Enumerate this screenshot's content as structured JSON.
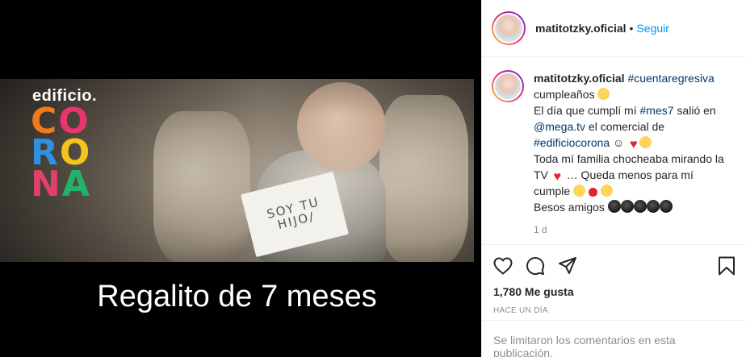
{
  "media": {
    "logo_small": "edificio.",
    "logo_letters": [
      "CO",
      "RO",
      "NA"
    ],
    "note_text": "SOY TU HIJO/",
    "caption": "Regalito de 7 meses"
  },
  "header": {
    "username": "matitotzky.oficial",
    "separator": "•",
    "follow_label": "Seguir"
  },
  "post": {
    "username": "matitotzky.oficial",
    "hashtag_countdown": "#cuentaregresiva",
    "line1": " cumpleaños ",
    "line2_a": "El día que cumplí mí ",
    "hashtag_mes7": "#mes7",
    "line2_b": " salió en ",
    "mention": "@mega.tv",
    "line3": " el comercial de ",
    "hashtag_building": "#edificiocorona",
    "line3_b": " ☺ ",
    "line4": "Toda mí familia chocheaba mirando la TV ",
    "line4_b": " … Queda menos para mí cumple ",
    "line5": "Besos amigos ",
    "time": "1 d"
  },
  "actions": {
    "likes": "1,780 Me gusta",
    "date": "HACE UN DÍA"
  },
  "footer": {
    "comments_disabled": "Se limitaron los comentarios en esta publicación."
  },
  "icons": [
    "heart-icon",
    "comment-icon",
    "share-icon",
    "bookmark-icon"
  ]
}
